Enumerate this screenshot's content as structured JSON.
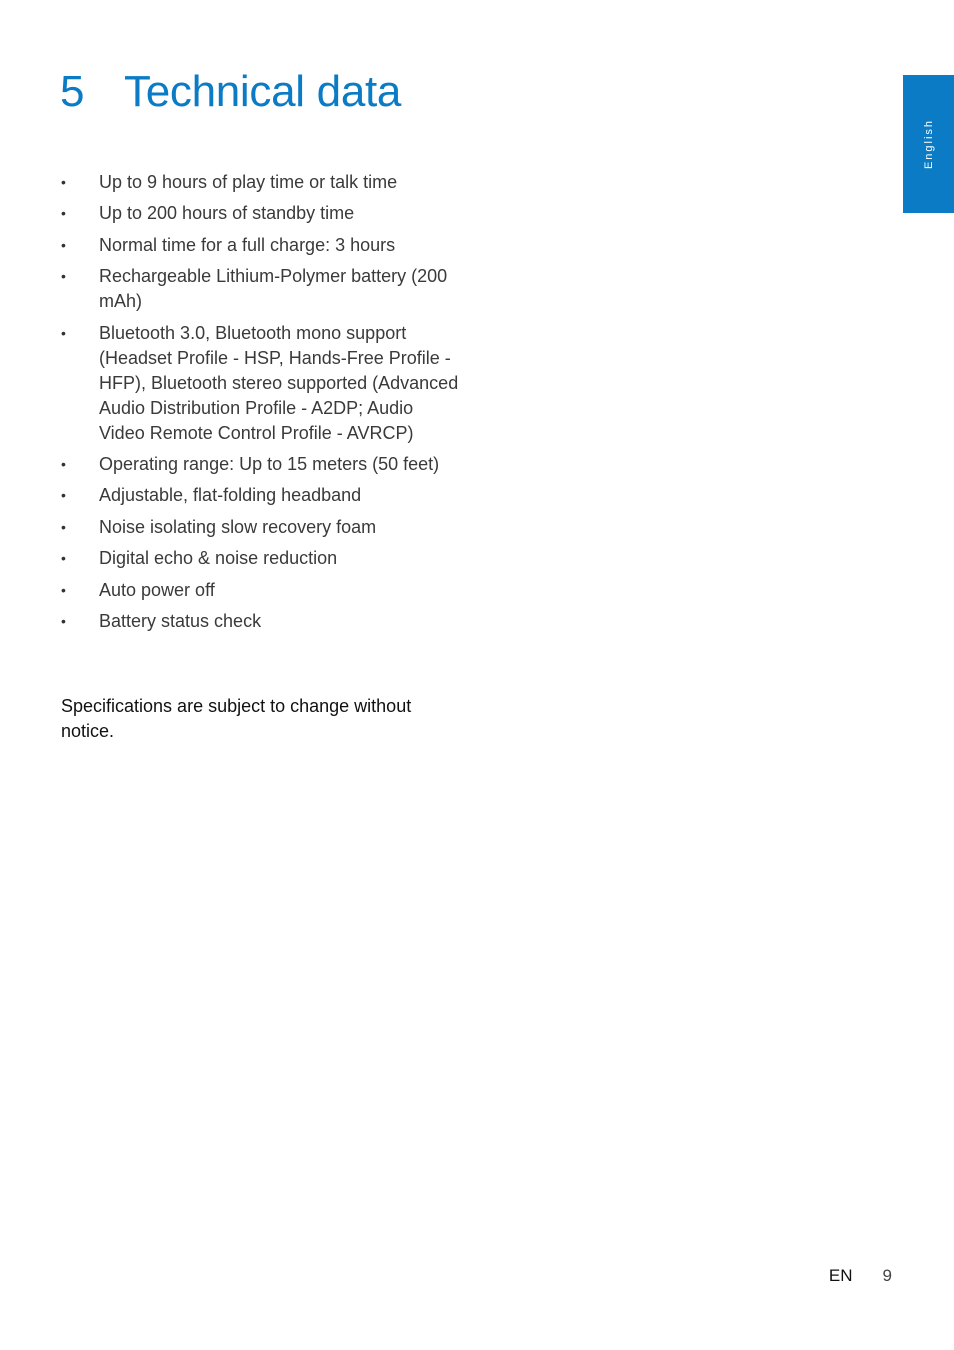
{
  "header": {
    "section_number": "5",
    "title": "Technical data"
  },
  "side_tab": {
    "label": "English",
    "color": "#0a7bc4"
  },
  "specs": [
    "Up to 9 hours of play time or talk time",
    "Up to 200 hours of standby time",
    "Normal time for a full charge: 3 hours",
    "Rechargeable Lithium-Polymer battery (200 mAh)",
    "Bluetooth 3.0, Bluetooth mono support (Headset Profile - HSP, Hands-Free Profile - HFP), Bluetooth stereo supported (Advanced Audio Distribution Profile - A2DP; Audio Video Remote Control Profile - AVRCP)",
    "Operating range: Up to 15 meters (50 feet)",
    "Adjustable, flat-folding headband",
    "Noise isolating slow recovery foam",
    "Digital echo & noise reduction",
    "Auto power off",
    "Battery status check"
  ],
  "bullet_glyph": "•",
  "note": "Specifications are subject to change without notice.",
  "footer": {
    "language_code": "EN",
    "page_number": "9"
  }
}
